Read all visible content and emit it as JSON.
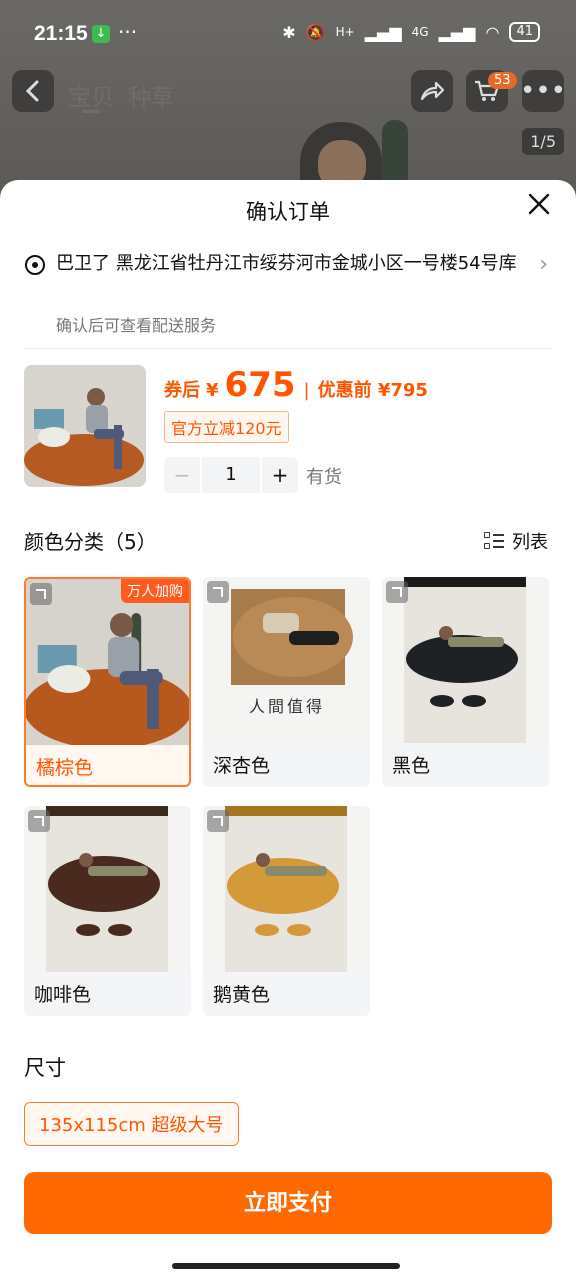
{
  "status": {
    "time": "21:15",
    "network": "H+",
    "network2": "4G",
    "battery": "41"
  },
  "nav": {
    "tab1": "宝贝",
    "tab2": "种草",
    "cart_count": "53",
    "image_index": "1/5"
  },
  "sheet": {
    "title": "确认订单",
    "address": "巴卫了 黑龙江省牡丹江市绥芬河市金城小区一号楼54号库",
    "address_sub": "确认后可查看配送服务",
    "price_label": "券后",
    "currency": "¥",
    "price": "675",
    "price_before": "优惠前 ¥795",
    "coupon": "官方立减120元",
    "quantity": "1",
    "stock": "有货",
    "color_title": "颜色分类（5）",
    "list_label": "列表",
    "hot_badge": "万人加购",
    "colors": [
      {
        "label": "橘棕色"
      },
      {
        "label": "深杏色"
      },
      {
        "label": "黑色"
      },
      {
        "label": "咖啡色"
      },
      {
        "label": "鹅黄色"
      }
    ],
    "poster_text": "人間值得",
    "size_title": "尺寸",
    "size_option": "135x115cm 超级大号",
    "pay_button": "立即支付"
  }
}
